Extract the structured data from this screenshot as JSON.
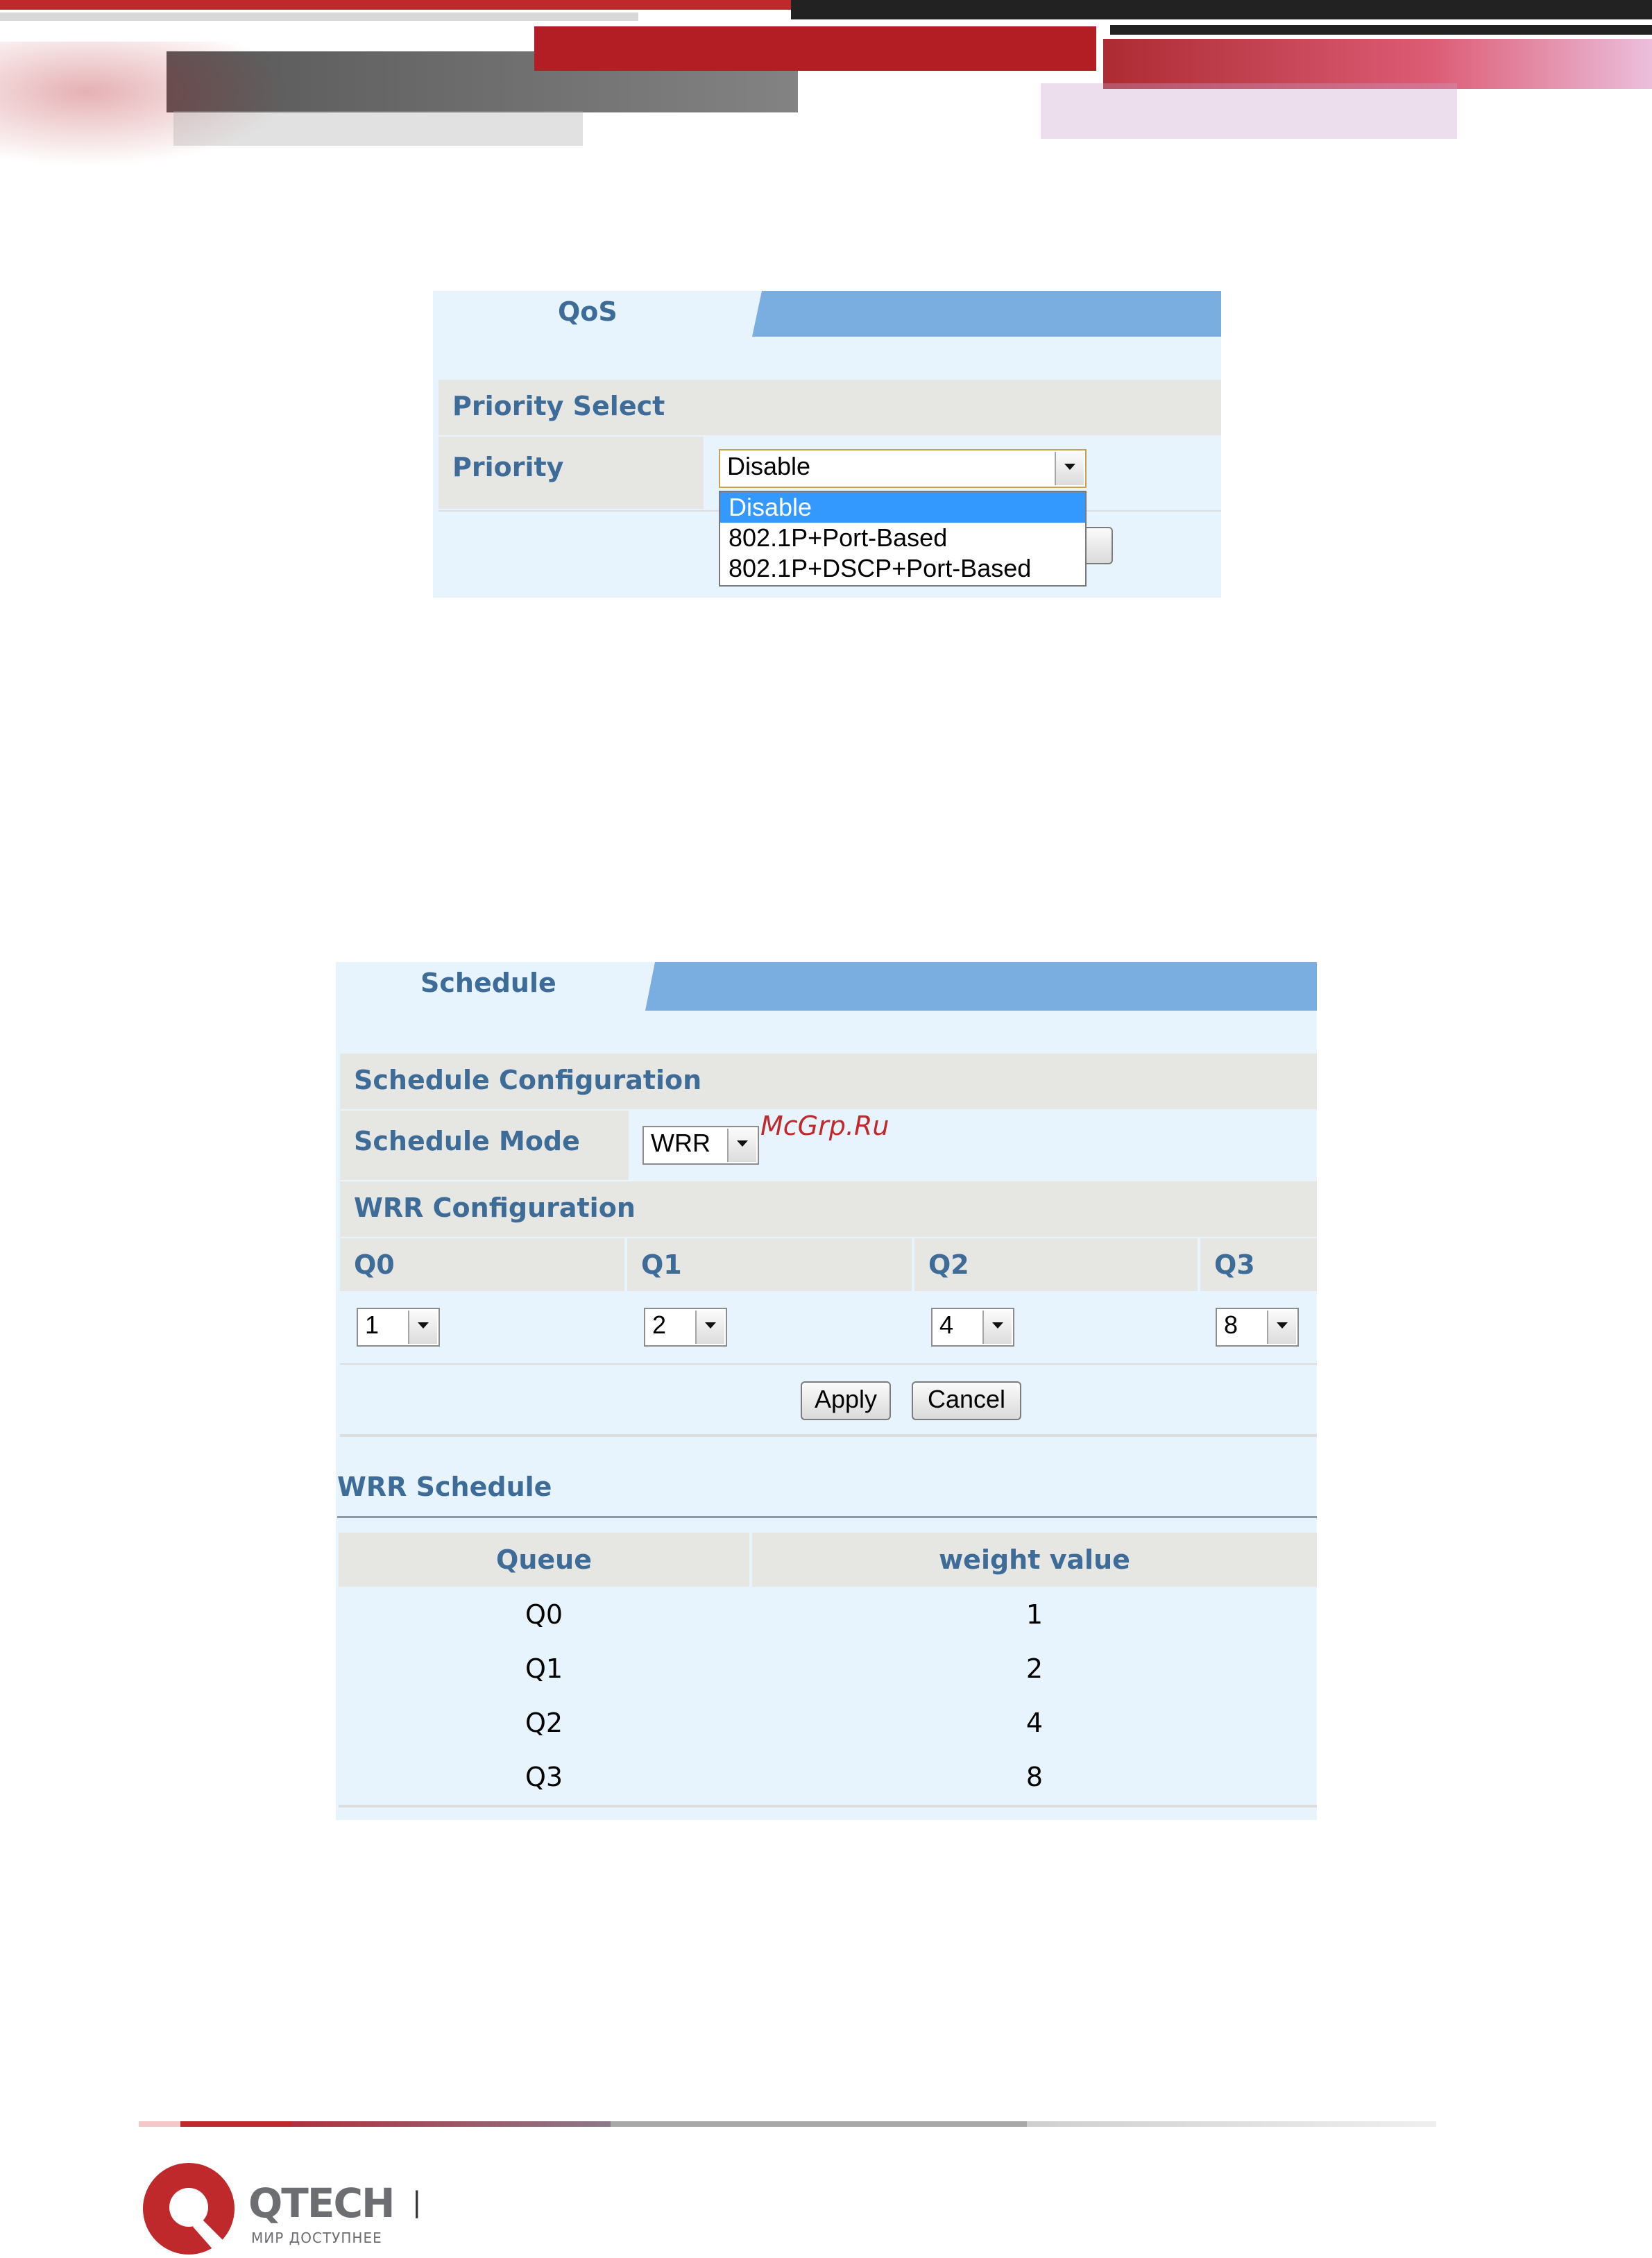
{
  "qos_panel": {
    "tab_label": "QoS",
    "section_title": "Priority Select",
    "priority_label": "Priority",
    "priority_value": "Disable",
    "priority_options": [
      "Disable",
      "802.1P+Port-Based",
      "802.1P+DSCP+Port-Based"
    ]
  },
  "schedule_panel": {
    "tab_label": "Schedule",
    "config_title": "Schedule Configuration",
    "mode_label": "Schedule Mode",
    "mode_value": "WRR",
    "wrr_config_title": "WRR Configuration",
    "queues": [
      {
        "label": "Q0",
        "value": "1"
      },
      {
        "label": "Q1",
        "value": "2"
      },
      {
        "label": "Q2",
        "value": "4"
      },
      {
        "label": "Q3",
        "value": "8"
      }
    ],
    "apply_label": "Apply",
    "cancel_label": "Cancel",
    "wrr_schedule_title": "WRR Schedule",
    "table": {
      "headers": [
        "Queue",
        "weight value"
      ],
      "rows": [
        [
          "Q0",
          "1"
        ],
        [
          "Q1",
          "2"
        ],
        [
          "Q2",
          "4"
        ],
        [
          "Q3",
          "8"
        ]
      ]
    }
  },
  "watermark": "McGrp.Ru",
  "footer": {
    "brand": "QTECH",
    "tagline": "МИР ДОСТУПНЕЕ",
    "separator": "|"
  },
  "colors": {
    "brand_red": "#c0292b",
    "label_blue": "#3d6c99",
    "tab_bar": "#7aaee0",
    "panel_bg": "#e8f4fd",
    "section_bg": "#e6e6e2",
    "highlight": "#3399ff"
  }
}
